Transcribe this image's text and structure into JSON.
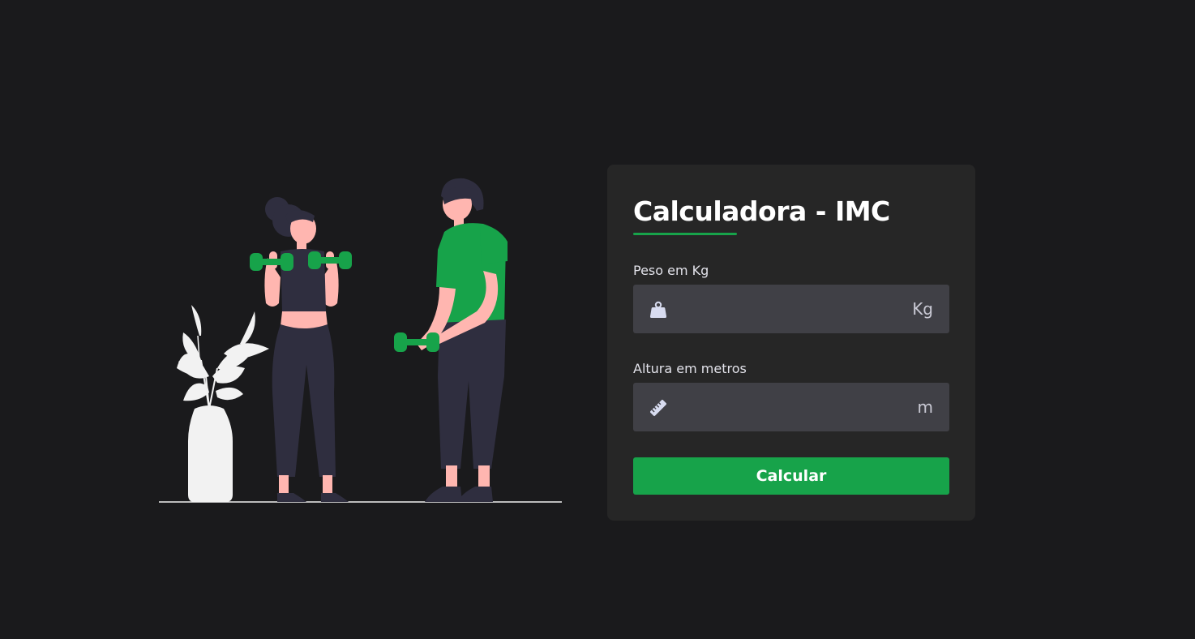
{
  "card": {
    "title": "Calculadora - IMC"
  },
  "weight": {
    "label": "Peso em Kg",
    "value": "",
    "unit": "Kg",
    "icon": "weight-icon"
  },
  "height": {
    "label": "Altura em metros",
    "value": "",
    "unit": "m",
    "icon": "ruler-icon"
  },
  "actions": {
    "calculate_label": "Calcular"
  },
  "colors": {
    "background": "#1a1a1c",
    "card": "#262626",
    "input": "#404046",
    "accent": "#17a34a",
    "skin": "#ffb6b0",
    "clothing": "#2f2e3f",
    "plant": "#f2f2f2"
  }
}
